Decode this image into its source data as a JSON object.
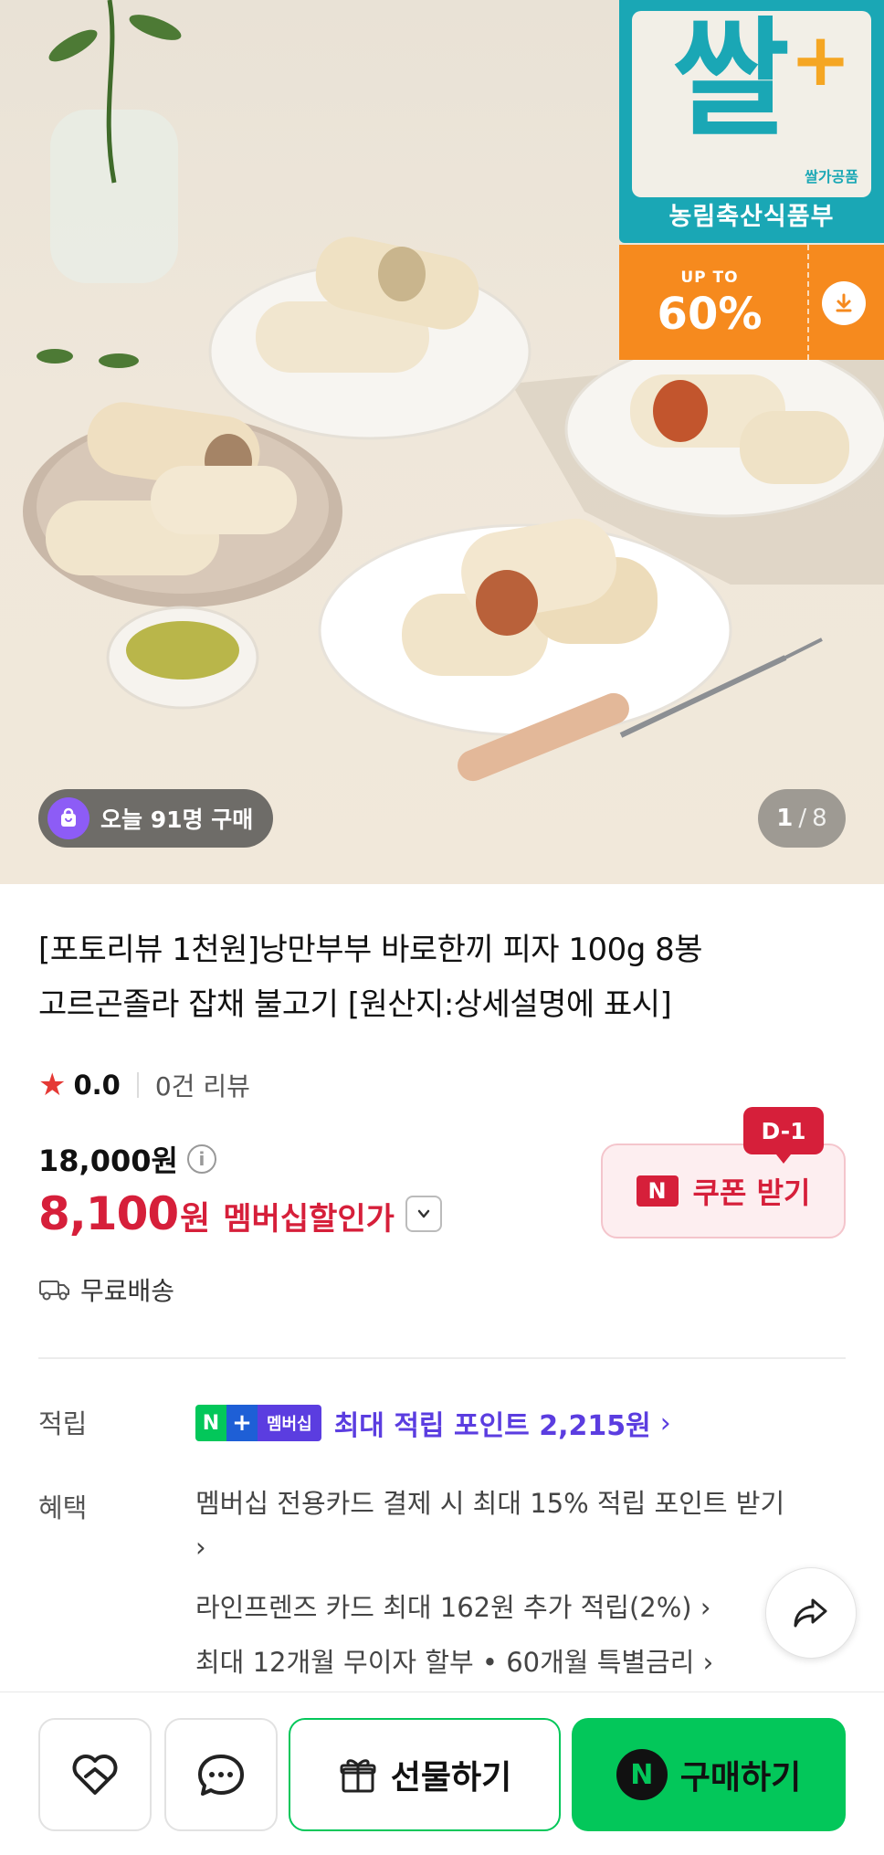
{
  "hero": {
    "brand_badge": {
      "mark": "쌀",
      "tiny_text": "쌀가공품",
      "subtitle": "농림축산식품부"
    },
    "sale_badge": {
      "up_to": "UP TO",
      "percent": "60%"
    },
    "today_buyers": "오늘 91명 구매",
    "pager": {
      "current": "1",
      "separator": "/",
      "total": "8"
    }
  },
  "product": {
    "title_line1": "[포토리뷰 1천원]낭만부부 바로한끼 피자 100g 8봉",
    "title_line2": "고르곤졸라 잡채 불고기 [원산지:상세설명에 표시]",
    "rating": {
      "star": "★",
      "score": "0.0",
      "reviews": "0건 리뷰"
    },
    "original_price": "18,000원",
    "sale_price_number": "8,100",
    "sale_price_unit": "원",
    "sale_label": "멤버십할인가",
    "shipping": "무료배송"
  },
  "coupon": {
    "dday": "D-1",
    "logo": "N",
    "label": "쿠폰 받기"
  },
  "points": {
    "label": "적립",
    "badge_n": "N",
    "badge_plus": "+",
    "badge_text": "멤버십",
    "text": "최대 적립 포인트 2,215원",
    "arrow": "›"
  },
  "benefits": {
    "label": "혜택",
    "items": [
      "멤버십 전용카드 결제 시 최대 15% 적립 포인트 받기",
      "라인프렌즈 카드 최대 162원 추가 적립(2%)",
      "최대 12개월 무이자 할부 • 60개월 특별금리"
    ],
    "arrow": "›"
  },
  "bottom_bar": {
    "gift_label": "선물하기",
    "buy_logo": "N",
    "buy_label": "구매하기"
  },
  "colors": {
    "accent_red": "#d61f3a",
    "naver_green": "#03c75a",
    "membership_purple": "#5b3de0",
    "brand_teal": "#1aa7b5",
    "sale_orange": "#f68a1e"
  }
}
